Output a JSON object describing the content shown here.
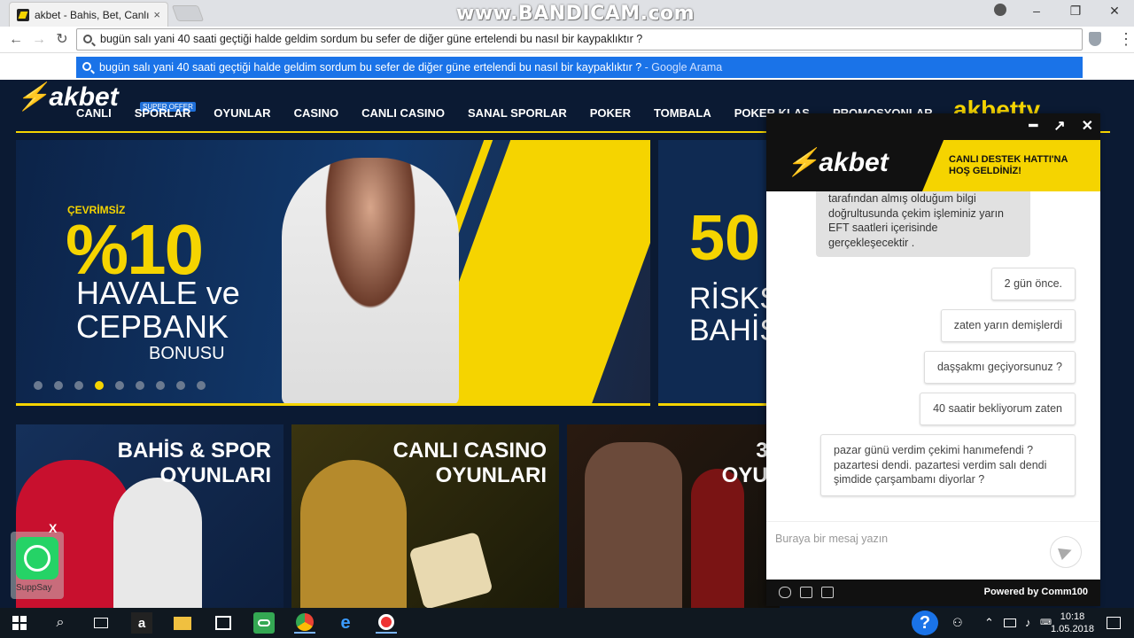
{
  "browser": {
    "tab_title": "akbet - Bahis, Bet, Canlı E",
    "tab_close": "×",
    "watermark": "www.BANDICAM.com",
    "min": "–",
    "max": "❐",
    "close": "✕",
    "back": "←",
    "forward": "→",
    "reload": "↻",
    "omnibox_value": "bugün salı yani 40 saati geçtiği halde geldim sordum bu sefer de diğer güne ertelendi bu nasıl bir kaypaklıktır ?",
    "suggestion_text": "bugün salı yani 40 saati geçtiği halde geldim sordum bu sefer de diğer güne ertelendi bu nasıl bir kaypaklıktır ?",
    "suggestion_hint": " - Google Arama",
    "menu_icon": "⋮"
  },
  "site": {
    "logo_text": "akbet",
    "super_offer": "SUPER OFFER",
    "menu": [
      "CANLI",
      "SPORLAR",
      "OYUNLAR",
      "CASINO",
      "CANLI CASINO",
      "SANAL SPORLAR",
      "POKER",
      "TOMBALA",
      "POKER KLAS",
      "PROMOSYONLAR"
    ],
    "right_logo": "akbetty",
    "hero": {
      "label": "ÇEVRİMSİZ",
      "big": "%10",
      "line1": "HAVALE ve",
      "line2": "CEPBANK",
      "line3": "BONUSU"
    },
    "hero2": {
      "big": "50",
      "line1": "RİSKS",
      "line2": "BAHİS"
    },
    "cards": [
      {
        "title": "BAHİS & SPOR\nOYUNLARI"
      },
      {
        "title": "CANLI CASINO\nOYUNLARI"
      },
      {
        "title": "3D\nOYUN"
      }
    ],
    "whatsapp_close": "X",
    "whatsapp_label": "SuppSay"
  },
  "chat": {
    "controls": [
      "━",
      "↗",
      "✕"
    ],
    "logo_text": "akbet",
    "welcome": "CANLI DESTEK HATTI'NA\nHOŞ GELDİNİZ!",
    "agent_msg": "tarafından almış olduğum bilgi doğrultusunda çekim işleminiz yarın EFT saatleri içerisinde gerçekleşecektir .",
    "user_msgs": [
      "2 gün önce.",
      "zaten yarın demişlerdi",
      "daşşakmı geçiyorsunuz ?",
      "40 saatir bekliyorum zaten",
      "pazar günü verdim çekimi hanımefendi ? pazartesi dendi. pazartesi verdim salı dendi şimdide çarşambamı diyorlar ?"
    ],
    "input_placeholder": "Buraya bir mesaj yazın",
    "powered_by": "Powered by Comm100"
  },
  "taskbar": {
    "help": "?",
    "clock_time": "10:18",
    "clock_date": "1.05.2018",
    "tray_icons": [
      "people-icon",
      "chevron-up-icon",
      "network-icon",
      "volume-icon",
      "keyboard-icon",
      "notifications-icon"
    ]
  }
}
